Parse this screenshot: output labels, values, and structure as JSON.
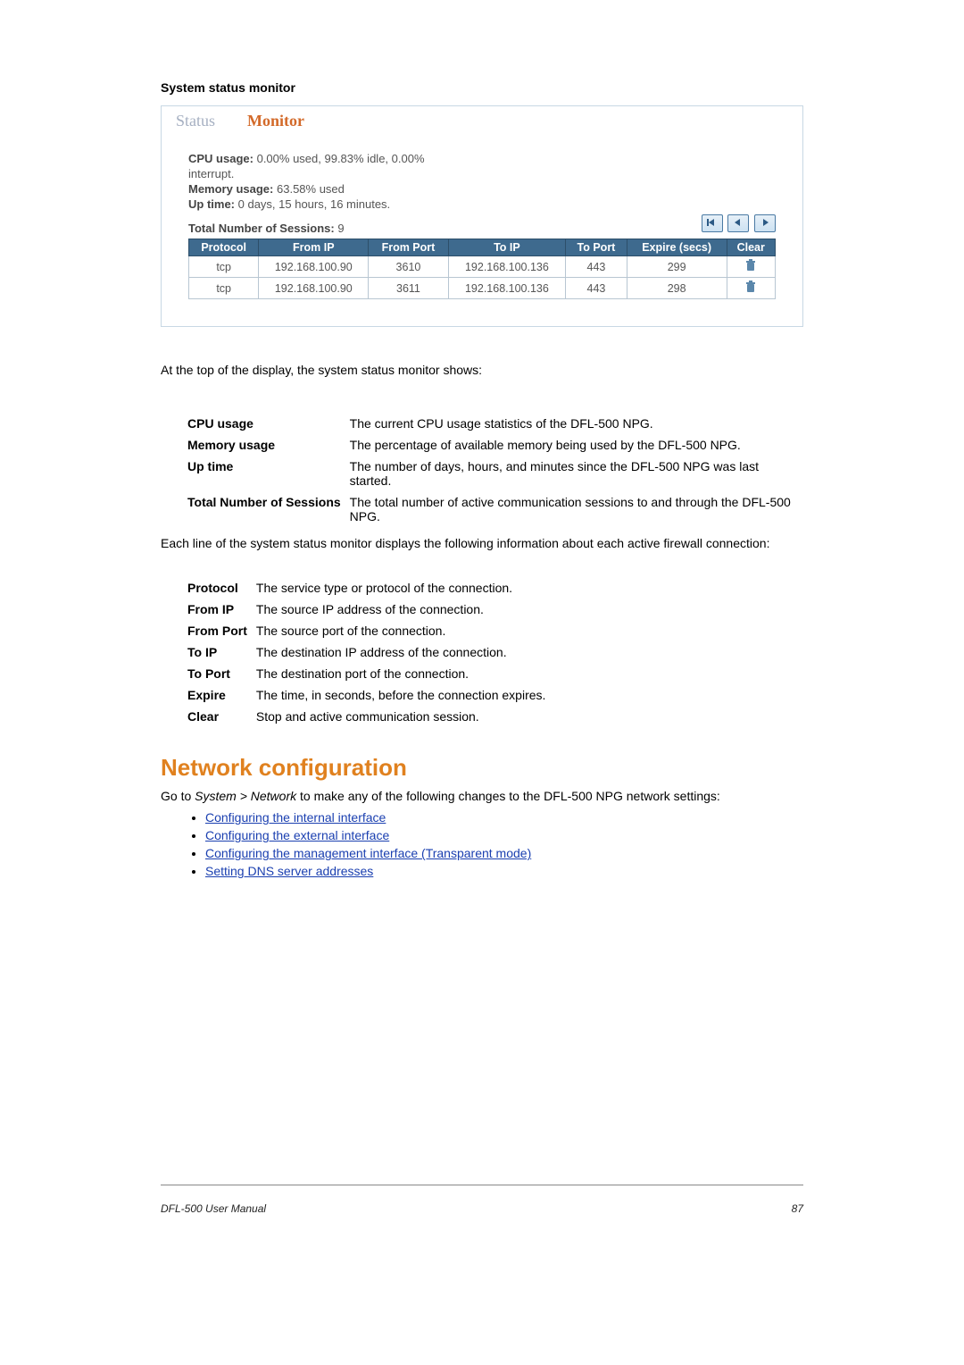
{
  "section_label": "System status monitor",
  "tabs": {
    "status": "Status",
    "monitor": "Monitor"
  },
  "monitor": {
    "cpu_label": "CPU usage:",
    "cpu_value": "0.00% used,  99.83% idle,   0.00%",
    "interrupt": "interrupt.",
    "mem_label": "Memory usage:",
    "mem_value": "63.58% used",
    "uptime_label": "Up time:",
    "uptime_value": "0 days,  15 hours,  16 minutes.",
    "sessions_label": "Total Number of Sessions:",
    "sessions_value": "9"
  },
  "session_headers": {
    "protocol": "Protocol",
    "from_ip": "From IP",
    "from_port": "From Port",
    "to_ip": "To IP",
    "to_port": "To Port",
    "expire": "Expire (secs)",
    "clear": "Clear"
  },
  "session_rows": [
    {
      "protocol": "tcp",
      "from_ip": "192.168.100.90",
      "from_port": "3610",
      "to_ip": "192.168.100.136",
      "to_port": "443",
      "expire": "299"
    },
    {
      "protocol": "tcp",
      "from_ip": "192.168.100.90",
      "from_port": "3611",
      "to_ip": "192.168.100.136",
      "to_port": "443",
      "expire": "298"
    }
  ],
  "paragraph1": "At the top of the display, the system status monitor shows:",
  "top_defs": [
    {
      "term": "CPU usage",
      "desc": "The current CPU usage statistics of the DFL-500 NPG."
    },
    {
      "term": "Memory usage",
      "desc": "The percentage of available memory being used by the DFL-500 NPG."
    },
    {
      "term": "Up time",
      "desc": "The number of days, hours, and minutes since the DFL-500 NPG was last started."
    },
    {
      "term": "Total Number of Sessions",
      "desc": "The total number of active communication sessions to and through the DFL-500 NPG."
    }
  ],
  "paragraph2": "Each line of the system status monitor displays the following information about each active firewall connection:",
  "col_defs": [
    {
      "term": "Protocol",
      "desc": "The service type or protocol of the connection."
    },
    {
      "term": "From IP",
      "desc": "The source IP address of the connection."
    },
    {
      "term": "From Port",
      "desc": "The source port of the connection."
    },
    {
      "term": "To IP",
      "desc": "The destination IP address of the connection."
    },
    {
      "term": "To Port",
      "desc": "The destination port of the connection."
    },
    {
      "term": "Expire",
      "desc": "The time, in seconds, before the connection expires."
    },
    {
      "term": "Clear",
      "desc": "Stop and active communication session."
    }
  ],
  "net_heading": "Network configuration",
  "net_intro_pre": "Go to ",
  "net_intro_em": "System > Network",
  "net_intro_post": " to make any of the following changes to the DFL-500 NPG network settings:",
  "net_links": [
    "Configuring the internal interface",
    "Configuring the external interface",
    "Configuring the management interface (Transparent mode)",
    "Setting DNS server addresses"
  ],
  "footer": {
    "left": "DFL-500 User Manual",
    "right": "87"
  }
}
